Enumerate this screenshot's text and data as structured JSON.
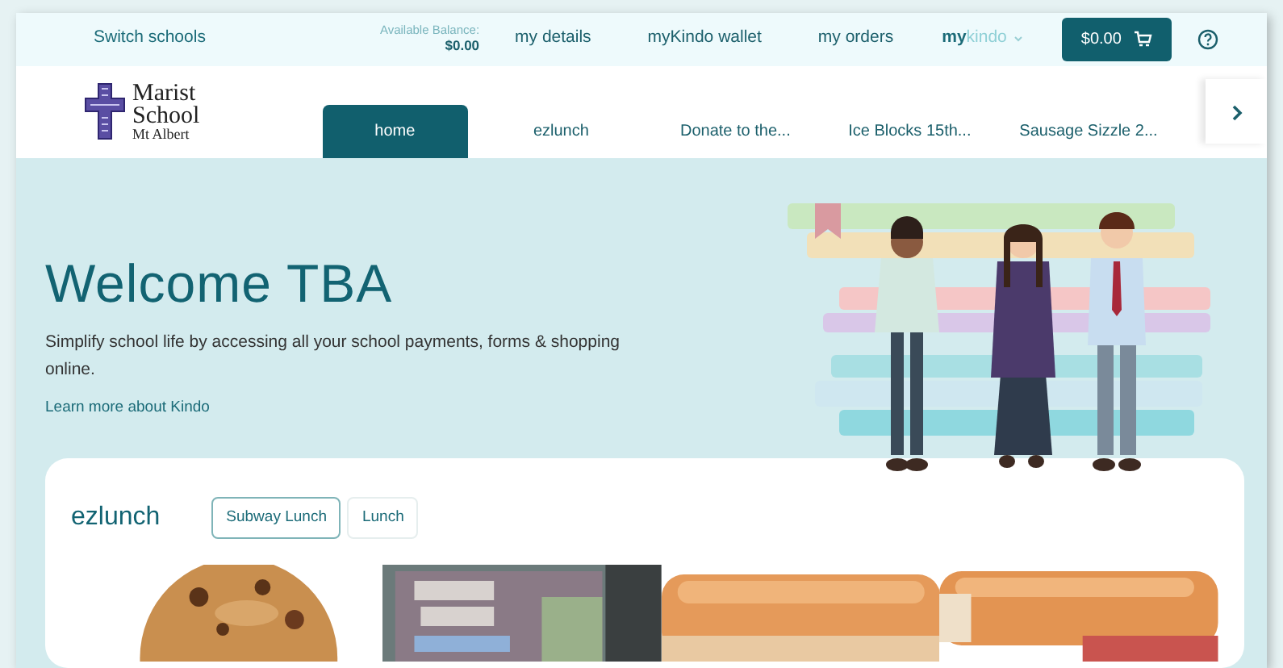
{
  "header": {
    "switch_link": "Switch schools",
    "balance_label": "Available Balance:",
    "balance_value": "$0.00",
    "nav_links": [
      "my details",
      "myKindo wallet",
      "my orders"
    ],
    "account_menu": "**my**kindo",
    "cart_total": "$0.00"
  },
  "school_logo": {
    "name_line_1": "Marist",
    "name_line_2": "School",
    "name_line_3": "Mt Albert"
  },
  "tabs": [
    {
      "label": "home",
      "selected": true
    },
    {
      "label": "ezlunch",
      "selected": false
    },
    {
      "label": "Donate to the...",
      "selected": false
    },
    {
      "label": "Ice Blocks 15th...",
      "selected": false
    },
    {
      "label": "Sausage Sizzle 2...",
      "selected": false
    }
  ],
  "hero": {
    "title": "Welcome TBA",
    "text": "Simplify school life by accessing all your school payments, forms & shopping online.",
    "link": "Learn more about Kindo"
  },
  "shop": {
    "title": "ezlunch",
    "filters": [
      {
        "label": "Subway Lunch",
        "selected": true
      },
      {
        "label": "Lunch",
        "selected": false
      }
    ]
  }
}
